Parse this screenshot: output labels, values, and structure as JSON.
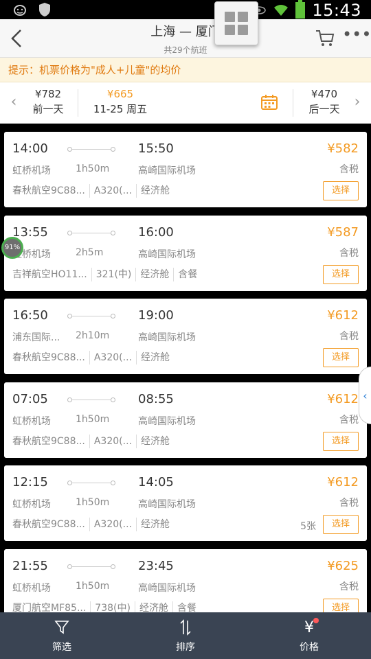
{
  "status_bar": {
    "time": "15:43",
    "icons": [
      "cat-face-icon",
      "shield-icon",
      "eye-icon",
      "wifi-icon",
      "battery-icon"
    ]
  },
  "header": {
    "title": "上海 — 厦门",
    "subtitle": "共29个航班",
    "icons": [
      "back-icon",
      "cart-icon",
      "more-icon"
    ]
  },
  "tip": {
    "text": "提示：机票价格为\"成人+儿童\"的均价"
  },
  "date_bar": {
    "prev": {
      "price": "¥782",
      "label": "前一天"
    },
    "current": {
      "price": "¥665",
      "label": "11-25 周五"
    },
    "next": {
      "price": "¥470",
      "label": "后一天"
    }
  },
  "overlay": {
    "badge": "91%"
  },
  "flights": [
    {
      "dep_time": "14:00",
      "arr_time": "15:50",
      "dep_airport": "虹桥机场",
      "duration": "1h50m",
      "arr_airport": "高崎国际机场",
      "price": "¥582",
      "tax": "含税",
      "airline": "春秋航空9C88...",
      "aircraft": "A320(...",
      "cabin": "经济舱",
      "meal": "",
      "seats": "",
      "select": "选择"
    },
    {
      "dep_time": "13:55",
      "arr_time": "16:00",
      "dep_airport": "虹桥机场",
      "duration": "2h5m",
      "arr_airport": "高崎国际机场",
      "price": "¥587",
      "tax": "含税",
      "airline": "吉祥航空HO11...",
      "aircraft": "321(中)",
      "cabin": "经济舱",
      "meal": "含餐",
      "seats": "",
      "select": "选择"
    },
    {
      "dep_time": "16:50",
      "arr_time": "19:00",
      "dep_airport": "浦东国际...",
      "duration": "2h10m",
      "arr_airport": "高崎国际机场",
      "price": "¥612",
      "tax": "含税",
      "airline": "春秋航空9C88...",
      "aircraft": "A320(...",
      "cabin": "经济舱",
      "meal": "",
      "seats": "",
      "select": "选择"
    },
    {
      "dep_time": "07:05",
      "arr_time": "08:55",
      "dep_airport": "虹桥机场",
      "duration": "1h50m",
      "arr_airport": "高崎国际机场",
      "price": "¥612",
      "tax": "含税",
      "airline": "春秋航空9C88...",
      "aircraft": "A320(...",
      "cabin": "经济舱",
      "meal": "",
      "seats": "",
      "select": "选择"
    },
    {
      "dep_time": "12:15",
      "arr_time": "14:05",
      "dep_airport": "虹桥机场",
      "duration": "1h50m",
      "arr_airport": "高崎国际机场",
      "price": "¥612",
      "tax": "含税",
      "airline": "春秋航空9C88...",
      "aircraft": "A320(...",
      "cabin": "经济舱",
      "meal": "",
      "seats": "5张",
      "select": "选择"
    },
    {
      "dep_time": "21:55",
      "arr_time": "23:45",
      "dep_airport": "虹桥机场",
      "duration": "1h50m",
      "arr_airport": "高崎国际机场",
      "price": "¥625",
      "tax": "含税",
      "airline": "厦门航空MF85...",
      "aircraft": "738(中)",
      "cabin": "经济舱",
      "meal": "含餐",
      "seats": "",
      "select": "选择"
    }
  ],
  "tab_bar": {
    "filter": "筛选",
    "sort": "排序",
    "price": "价格"
  },
  "colors": {
    "accent": "#f39a22",
    "tip_bg": "#fdf5df",
    "tab_bar_bg": "#3a4453"
  }
}
